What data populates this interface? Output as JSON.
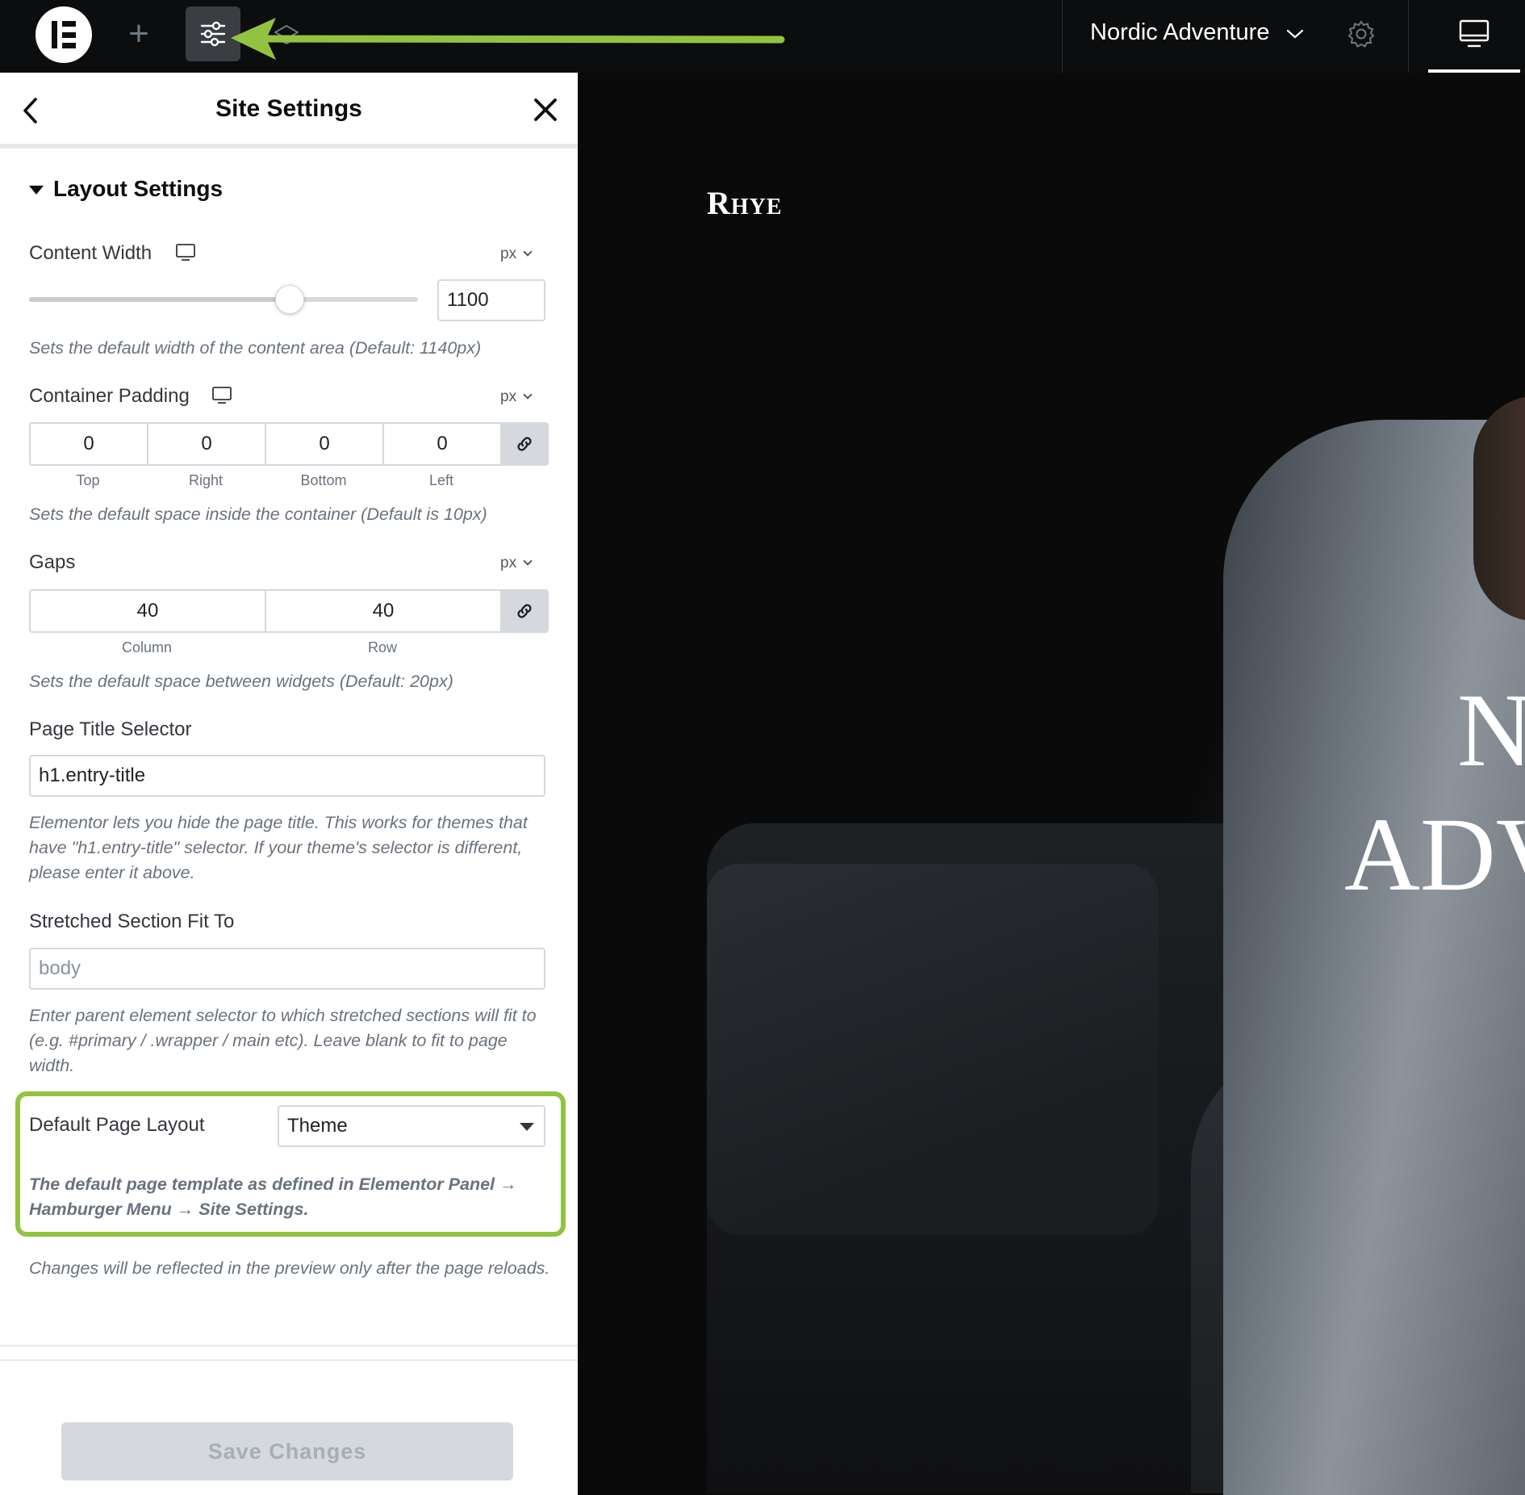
{
  "topbar": {
    "site_name": "Nordic Adventure",
    "add_symbol": "+",
    "icons": [
      "elementor-logo-icon",
      "plus-icon",
      "site-settings-icon",
      "layers-icon",
      "chevron-down-icon",
      "gear-icon",
      "desktop-icon"
    ]
  },
  "panel": {
    "title": "Site Settings",
    "section_title": "Layout Settings",
    "content_width": {
      "label": "Content Width",
      "unit": "px",
      "value": "1100",
      "slider_fraction": 0.67,
      "help": "Sets the default width of the content area (Default: 1140px)"
    },
    "container_padding": {
      "label": "Container Padding",
      "unit": "px",
      "values": [
        "0",
        "0",
        "0",
        "0"
      ],
      "sides": [
        "Top",
        "Right",
        "Bottom",
        "Left"
      ],
      "help": "Sets the default space inside the container (Default is 10px)"
    },
    "gaps": {
      "label": "Gaps",
      "unit": "px",
      "values": [
        "40",
        "40"
      ],
      "sides": [
        "Column",
        "Row"
      ],
      "help": "Sets the default space between widgets (Default: 20px)"
    },
    "page_title_selector": {
      "label": "Page Title Selector",
      "value": "h1.entry-title",
      "help": "Elementor lets you hide the page title. This works for themes that have \"h1.entry-title\" selector. If your theme's selector is different, please enter it above."
    },
    "stretched_section": {
      "label": "Stretched Section Fit To",
      "placeholder": "body",
      "help": "Enter parent element selector to which stretched sections will fit to (e.g. #primary / .wrapper / main etc). Leave blank to fit to page width."
    },
    "default_page_layout": {
      "label": "Default Page Layout",
      "value": "Theme",
      "help": "The default page template as defined in Elementor Panel → Hamburger Menu → Site Settings."
    },
    "reload_note": "Changes will be reflected in the preview only after the page reloads.",
    "save_label": "Save Changes"
  },
  "preview": {
    "brand": "Rhye",
    "hero_line1": "N",
    "hero_line2": "ADV"
  },
  "colors": {
    "topbar_bg": "#0c0d0e",
    "highlight": "#92c340",
    "arrow": "#92c340"
  }
}
